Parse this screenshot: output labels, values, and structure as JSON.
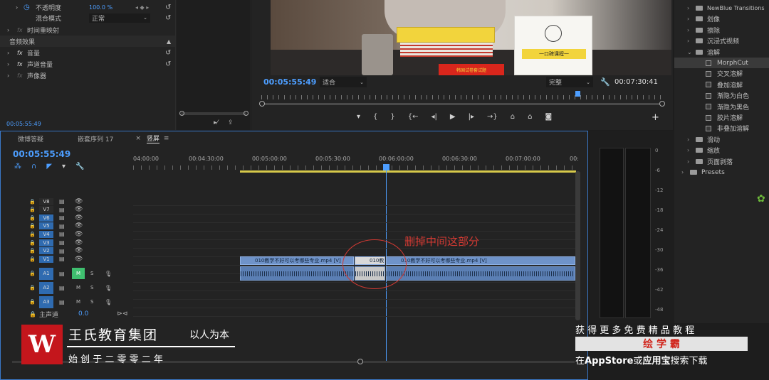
{
  "effect_controls": {
    "opacity_label": "不透明度",
    "opacity_value": "100.0 %",
    "blend_label": "混合模式",
    "blend_value": "正常",
    "time_remap_label": "时间重映射",
    "audio_section": "音频效果",
    "volume_label": "音量",
    "channel_volume_label": "声道音量",
    "panner_label": "声像器",
    "timecode": "00:05:55:49"
  },
  "program_monitor": {
    "timecode": "00:05:55:49",
    "fit": "适合",
    "quality": "完整",
    "duration": "00:07:30:41",
    "preview": {
      "books_text": "一口碑课程一",
      "box_text": "韩国试卷套试题"
    }
  },
  "effects_panel": {
    "items": [
      {
        "label": "NewBlue Transitions",
        "kind": "folder",
        "indent": 0
      },
      {
        "label": "划像",
        "kind": "folder",
        "indent": 0
      },
      {
        "label": "擦除",
        "kind": "folder",
        "indent": 0
      },
      {
        "label": "沉浸式视频",
        "kind": "folder",
        "indent": 0
      },
      {
        "label": "溶解",
        "kind": "folder-open",
        "indent": 0
      },
      {
        "label": "MorphCut",
        "kind": "file",
        "indent": 1
      },
      {
        "label": "交叉溶解",
        "kind": "file",
        "indent": 1
      },
      {
        "label": "叠加溶解",
        "kind": "file",
        "indent": 1
      },
      {
        "label": "渐隐为白色",
        "kind": "file",
        "indent": 1
      },
      {
        "label": "渐隐为黑色",
        "kind": "file",
        "indent": 1
      },
      {
        "label": "胶片溶解",
        "kind": "file",
        "indent": 1
      },
      {
        "label": "非叠加溶解",
        "kind": "file",
        "indent": 1
      },
      {
        "label": "滑动",
        "kind": "folder",
        "indent": 0
      },
      {
        "label": "缩放",
        "kind": "folder",
        "indent": 0
      },
      {
        "label": "页面剥落",
        "kind": "folder",
        "indent": 0
      },
      {
        "label": "Presets",
        "kind": "folder",
        "indent": -1
      }
    ]
  },
  "timeline": {
    "tabs": [
      "微博答疑",
      "嵌套序列 17",
      "竖屏"
    ],
    "timecode": "00:05:55:49",
    "ruler": [
      "04:00:00",
      "00:04:30:00",
      "00:05:00:00",
      "00:05:30:00",
      "00:06:00:00",
      "00:06:30:00",
      "00:07:00:00",
      "00:"
    ],
    "video_tracks": [
      "V8",
      "V7",
      "V6",
      "V5",
      "V4",
      "V3",
      "V2",
      "V1"
    ],
    "audio_tracks": [
      "A1",
      "A2",
      "A3"
    ],
    "master_label": "主声道",
    "master_value": "0.0",
    "clip_left": "010教学不好可以考哪些专业.mp4 [V]",
    "clip_mid": "010教",
    "clip_right": "010教学不好可以考哪些专业.mp4 [V]",
    "annotation": "删掉中间这部分"
  },
  "audio_meter": {
    "scale": [
      "0",
      "-6",
      "-12",
      "-18",
      "-24",
      "-30",
      "-36",
      "-42",
      "-48"
    ]
  },
  "watermark": {
    "brand": "王氏教育集团",
    "slogan": "以人为本",
    "since": "始 创 于 二 零 零 二 年",
    "promo_line1": "获 得 更 多 免 费 精 品 教 程",
    "promo_app": "绘 学 霸",
    "promo_line3_pre": "在",
    "promo_line3_store": "AppStore",
    "promo_line3_or": "或",
    "promo_line3_bao": "应用宝",
    "promo_line3_post": "搜索下载",
    "colors": {
      "red": "#c4161c",
      "accent": "#e03a2f"
    }
  }
}
